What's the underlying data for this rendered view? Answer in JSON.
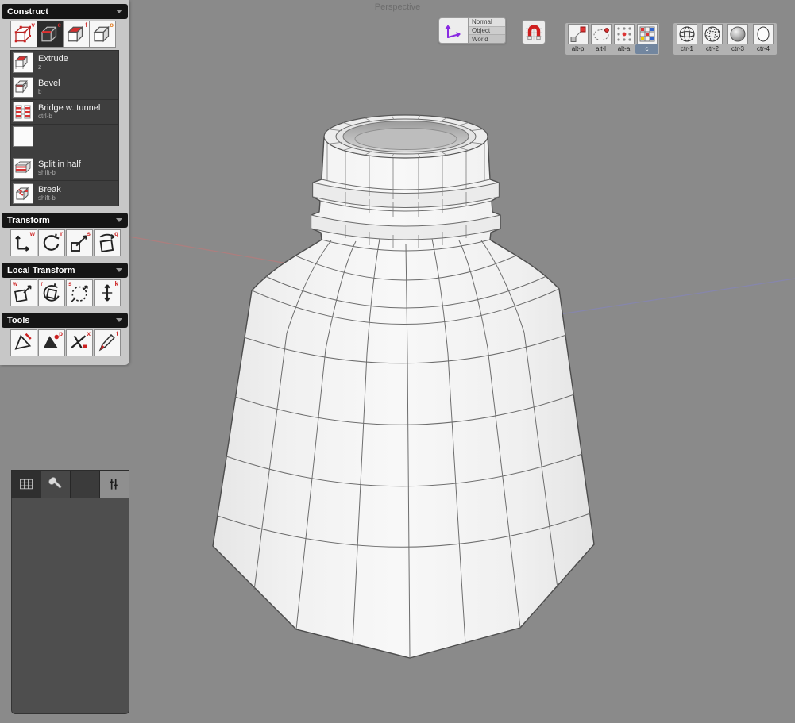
{
  "viewport": {
    "label": "Perspective"
  },
  "toolbar": {
    "space": {
      "options": [
        "Normal",
        "Object",
        "World"
      ]
    },
    "snap_group": {
      "labels": [
        "alt-p",
        "alt-l",
        "alt-a",
        "c"
      ]
    },
    "center_group": {
      "labels": [
        "ctr-1",
        "ctr-2",
        "ctr-3",
        "ctr-4"
      ]
    }
  },
  "sidebar": {
    "construct": {
      "title": "Construct",
      "modes": [
        {
          "key": "v"
        },
        {
          "key": "e"
        },
        {
          "key": "f"
        },
        {
          "key": "o"
        }
      ],
      "tools": [
        {
          "label": "Extrude",
          "shortcut": "z"
        },
        {
          "label": "Bevel",
          "shortcut": "b"
        },
        {
          "label": "Bridge w. tunnel",
          "shortcut": "ctrl-b"
        },
        {
          "label": "",
          "shortcut": ""
        },
        {
          "label": "Split in half",
          "shortcut": "shift-b"
        },
        {
          "label": "Break",
          "shortcut": "shift-b"
        }
      ]
    },
    "transform": {
      "title": "Transform",
      "keys": [
        "w",
        "r",
        "s",
        "q"
      ]
    },
    "local_transform": {
      "title": "Local Transform",
      "keys": [
        "w",
        "r",
        "s",
        "k"
      ]
    },
    "tools": {
      "title": "Tools",
      "keys": [
        "",
        "p",
        "x",
        "t"
      ]
    }
  }
}
